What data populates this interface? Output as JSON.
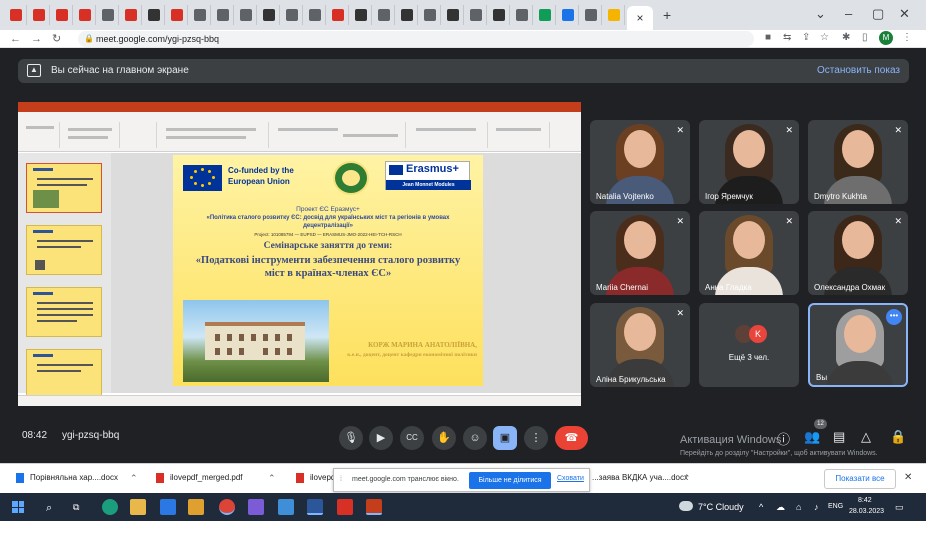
{
  "browser": {
    "tab_close": "×",
    "new_tab": "+",
    "url": "meet.google.com/ygi-pzsq-bbq",
    "profile_initial": "M",
    "tab_favicon_colors": [
      "#d93025",
      "#d93025",
      "#d93025",
      "#d93025",
      "#5f6368",
      "#d93025",
      "#333333",
      "#d93025",
      "#5f6368",
      "#5f6368",
      "#5f6368",
      "#333333",
      "#5f6368",
      "#5f6368",
      "#d93025",
      "#333333",
      "#5f6368",
      "#333333",
      "#5f6368",
      "#333333",
      "#5f6368",
      "#333333",
      "#5f6368",
      "#0f9d58",
      "#1a73e8",
      "#5f6368",
      "#f4b400"
    ]
  },
  "meet": {
    "presenting_banner": "Вы сейчас на главном экране",
    "stop_presenting": "Остановить показ",
    "time": "08:42",
    "code": "ygi-pzsq-bbq",
    "people_count": "12",
    "windows_activation_title": "Активация Windows",
    "windows_activation_sub": "Перейдіть до розділу \"Настройки\", щоб активувати Windows."
  },
  "slide": {
    "cofunded": "Co-funded by the European Union",
    "erasmus": "Erasmus+",
    "erasmus_sub": "Jean Monnet Modules",
    "project_label": "Проект ЄС Еразмус+",
    "project_topic": "«Політика сталого розвитку ЄС: досвід для українських міст та регіонів в умовах децентралізації»",
    "project_number": "Project: 101085794 — EUPSD — ERASMUS-JMO-2022-HEI-TCH-RSCH",
    "seminar": "Семінарське заняття до теми:",
    "title": "«Податкові інструменти забезпечення сталого розвитку міст в країнах-членах ЄС»",
    "author": "КОРЖ МАРИНА АНАТОЛІЇВНА,",
    "author_info": "к.е.н., доцент, доцент кафедри економічної політики"
  },
  "participants": [
    {
      "name": "Natalia Vojtenko",
      "hair": "#6b3f22",
      "body": "#4a5b7a"
    },
    {
      "name": "Ігор Яремчук",
      "hair": "#3a2a20",
      "body": "#1d1d1d"
    },
    {
      "name": "Dmytro Kukhta",
      "hair": "#3b2a1a",
      "body": "#6e6e6e"
    },
    {
      "name": "Mariia Chernai",
      "hair": "#4a2e1b",
      "body": "#8a2a2a"
    },
    {
      "name": "Анна Гладка",
      "hair": "#6b4a2c",
      "body": "#e9e3dc"
    },
    {
      "name": "Олександра Охмак",
      "hair": "#3d2718",
      "body": "#2a2a2a"
    },
    {
      "name": "Аліна Брикульська",
      "hair": "#7a5a3c",
      "body": "#3b3b3b"
    }
  ],
  "more": {
    "label": "Ещё 3 чел.",
    "avatar_letter": "K"
  },
  "self_label": "Вы",
  "downloads": {
    "item1": "Порівняльна хар....docx",
    "item2": "ilovepdf_merged.pdf",
    "item3": "ilovepd",
    "item4": "...заява ВКДКА уча....docx",
    "share_text": "meet.google.com транслює вікно.",
    "stop_share": "Більше не ділитися",
    "hide": "Сховати",
    "show_all": "Показати все"
  },
  "taskbar": {
    "weather": "7°C Cloudy",
    "lang": "ENG",
    "time": "8:42",
    "date": "28.03.2023"
  }
}
